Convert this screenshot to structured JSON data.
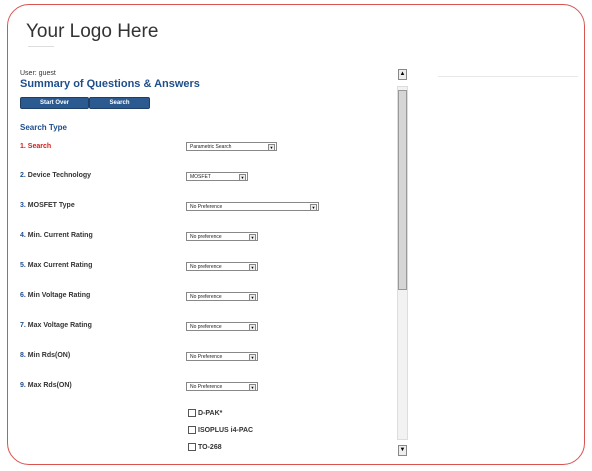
{
  "logo": {
    "text": "Your Logo Here"
  },
  "user": {
    "text": "User: guest"
  },
  "summary": {
    "title": "Summary of Questions & Answers"
  },
  "buttons": {
    "start_over": "Start Over",
    "search": "Search"
  },
  "search_type": {
    "label": "Search Type"
  },
  "questions": [
    {
      "num": "1.",
      "label": "Search",
      "value": "Parametric Search",
      "active": true
    },
    {
      "num": "2.",
      "label": "Device Technology",
      "value": "MOSFET"
    },
    {
      "num": "3.",
      "label": "MOSFET Type",
      "value": "No Preference"
    },
    {
      "num": "4.",
      "label": "Min. Current Rating",
      "value": "No preference"
    },
    {
      "num": "5.",
      "label": "Max Current Rating",
      "value": "No preference"
    },
    {
      "num": "6.",
      "label": "Min Voltage Rating",
      "value": "No preference"
    },
    {
      "num": "7.",
      "label": "Max Voltage Rating",
      "value": "No preference"
    },
    {
      "num": "8.",
      "label": "Min Rds(ON)",
      "value": "No Preference"
    },
    {
      "num": "9.",
      "label": "Max Rds(ON)",
      "value": "No Preference"
    }
  ],
  "packages": [
    "D-PAK*",
    "ISOPLUS i4-PAC",
    "TO-268"
  ],
  "scrollbar": {
    "up_icon": "▲",
    "down_icon": "▼"
  },
  "colors": {
    "accent": "#1f4e8c",
    "active": "#d61b1b",
    "frame": "#d9534f"
  }
}
